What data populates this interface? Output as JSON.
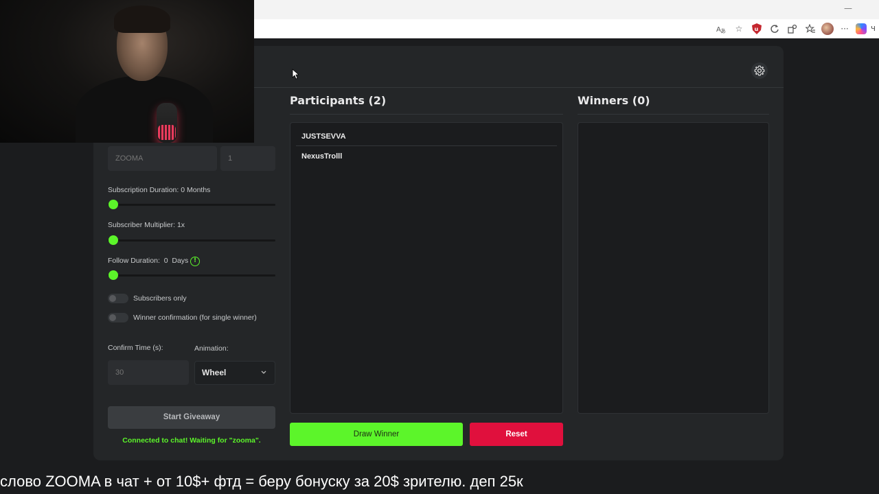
{
  "browser": {
    "toolbar_icons": [
      "translate-icon",
      "star-icon",
      "ublock-icon",
      "refresh-icon",
      "extensions-icon",
      "favorites-icon",
      "profile-avatar",
      "more-icon",
      "copilot-icon"
    ],
    "more_label": "···",
    "cut_text": "Ч"
  },
  "giveaway": {
    "keyword_placeholder": "ZOOMA",
    "winners_count_placeholder": "1",
    "subscription_duration_label": "Subscription Duration: 0 Months",
    "subscription_duration_value": 0,
    "subscriber_multiplier_label": "Subscriber Multiplier: 1x",
    "subscriber_multiplier_value": 1,
    "follow_duration_label": "Follow Duration:  0  Days",
    "follow_duration_value": 0,
    "info_symbol": "!",
    "subscribers_only_label": "Subscribers only",
    "subscribers_only": false,
    "winner_confirmation_label": "Winner confirmation (for single winner)",
    "winner_confirmation": false,
    "confirm_time_label": "Confirm Time (s):",
    "confirm_time_placeholder": "30",
    "animation_label": "Animation:",
    "animation_value": "Wheel",
    "start_button": "Start Giveaway",
    "status_text": "Connected to chat! Waiting for \"zooma\"."
  },
  "participants": {
    "title": "Participants (2)",
    "items": [
      "JUSTSEVVA",
      "NexusTrolll"
    ]
  },
  "winners": {
    "title": "Winners (0)",
    "items": []
  },
  "actions": {
    "draw_winner": "Draw Winner",
    "reset": "Reset"
  },
  "colors": {
    "accent_green": "#5cf52a",
    "reset_red": "#e0103d",
    "panel_bg": "#242628"
  },
  "caption": "слово ZOOMA  в чат + от 10$+ фтд = беру бонуску за 20$ зрителю. деп 25к"
}
